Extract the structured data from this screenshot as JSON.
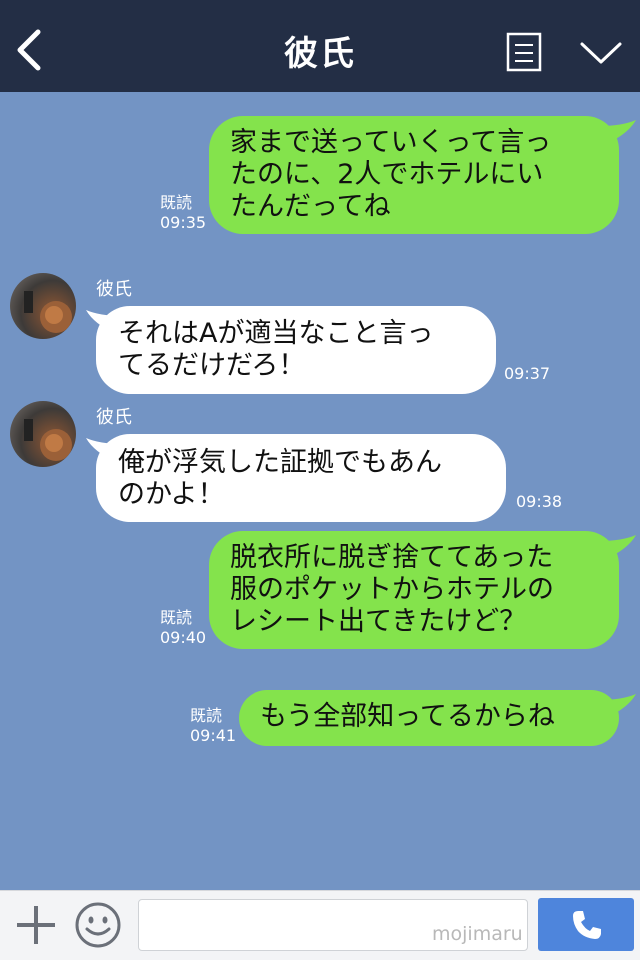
{
  "header": {
    "title": "彼氏",
    "back_icon": "back-chevron-icon",
    "menu_icon": "note-list-icon",
    "expand_icon": "chevron-down-icon"
  },
  "colors": {
    "header_bg": "#232e45",
    "chat_bg": "#7394c4",
    "my_bubble": "#84e34c",
    "their_bubble": "#ffffff",
    "call_button": "#4e85dc"
  },
  "messages": [
    {
      "from": "me",
      "text": "家まで送っていくって言っ\nたのに、2人でホテルにい\nたんだってね",
      "read": "既読",
      "time": "09:35"
    },
    {
      "from": "them",
      "sender": "彼氏",
      "text": "それはAが適当なこと言っ\nてるだけだろ！",
      "time": "09:37"
    },
    {
      "from": "them",
      "sender": "彼氏",
      "text": "俺が浮気した証拠でもあん\nのかよ！",
      "time": "09:38"
    },
    {
      "from": "me",
      "text": "脱衣所に脱ぎ捨ててあった\n服のポケットからホテルの\nレシート出てきたけど？",
      "read": "既読",
      "time": "09:40"
    },
    {
      "from": "me",
      "text": "もう全部知ってるからね",
      "read": "既読",
      "time": "09:41"
    }
  ],
  "footer": {
    "plus_icon": "plus-icon",
    "emoji_icon": "smiley-icon",
    "input_value": "",
    "watermark": "mojimaru",
    "call_icon": "phone-icon"
  }
}
